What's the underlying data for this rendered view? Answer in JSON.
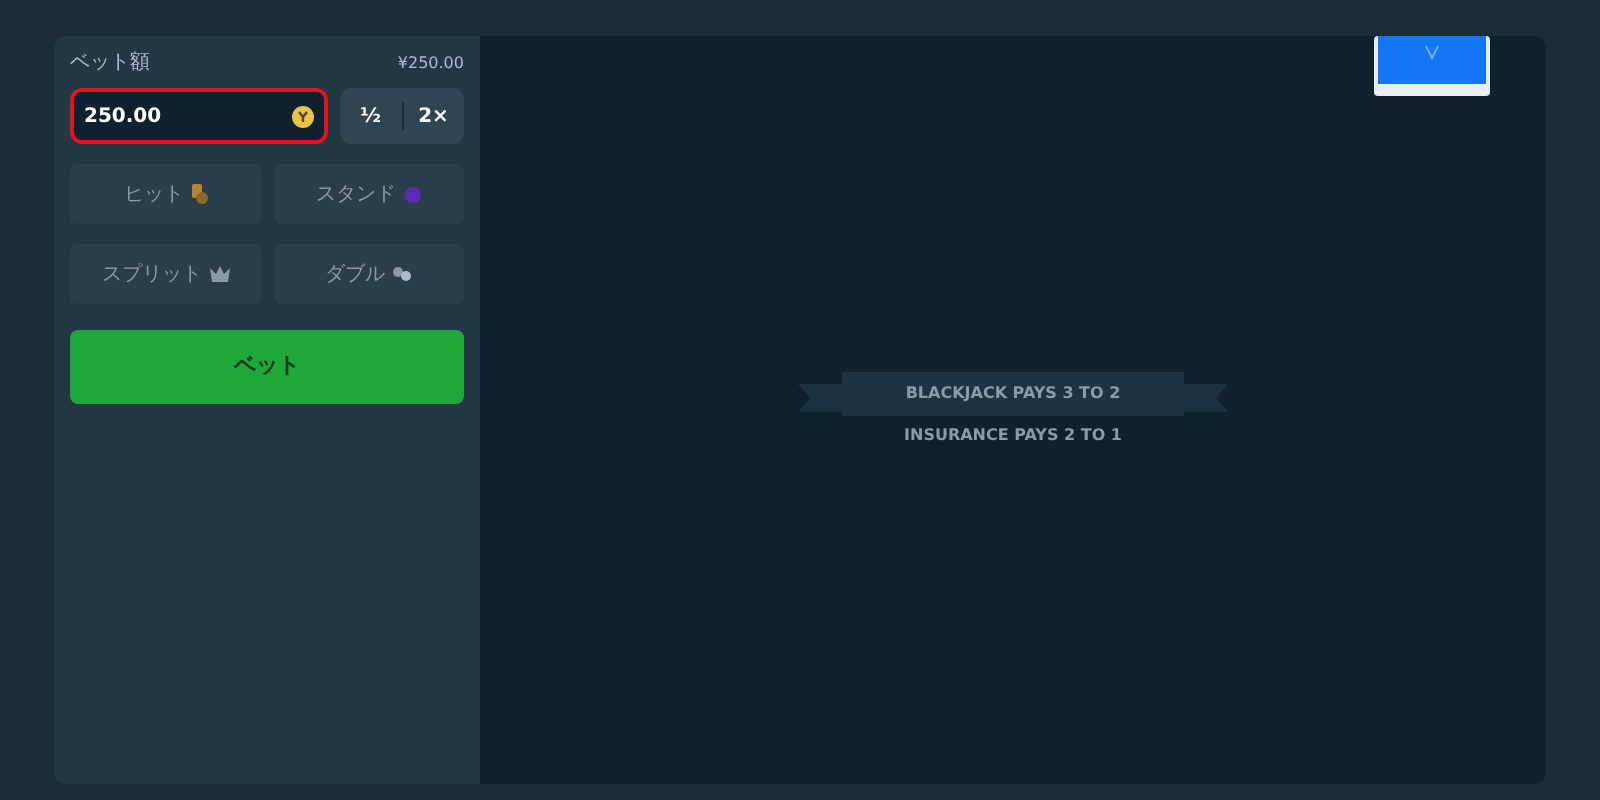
{
  "bet": {
    "label": "ベット額",
    "balance": "¥250.00",
    "value": "250.00",
    "half": "½",
    "double": "2×"
  },
  "actions": [
    {
      "label": "ヒット",
      "kind": "hit"
    },
    {
      "label": "スタンド",
      "kind": "stand"
    },
    {
      "label": "スプリット",
      "kind": "split"
    },
    {
      "label": "ダブル",
      "kind": "double"
    }
  ],
  "bet_button": "ベット",
  "table": {
    "banner": "BLACKJACK PAYS 3 TO 2",
    "insurance": "INSURANCE PAYS 2 TO 1"
  }
}
